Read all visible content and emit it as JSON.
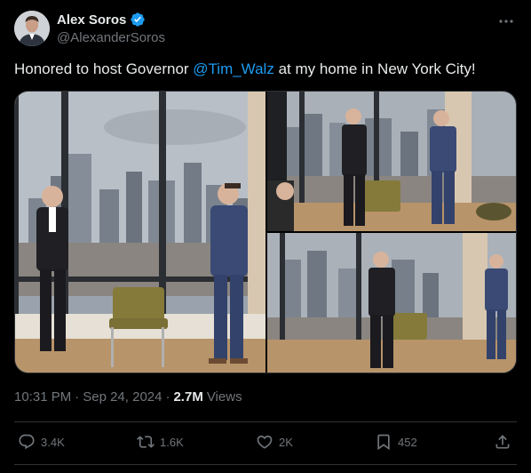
{
  "author": {
    "display_name": "Alex Soros",
    "handle": "@AlexanderSoros",
    "verified": true
  },
  "tweet": {
    "text_before": "Honored to host Governor ",
    "mention": "@Tim_Walz",
    "text_after": " at my home in New York City!"
  },
  "media": {
    "photo_count": 3
  },
  "meta": {
    "time": "10:31 PM",
    "date": "Sep 24, 2024",
    "views_count": "2.7M",
    "views_label": "Views",
    "separator": "·"
  },
  "actions": {
    "replies": "3.4K",
    "retweets": "1.6K",
    "likes": "2K",
    "bookmarks": "452"
  },
  "colors": {
    "background": "#000000",
    "text": "#e7e9ea",
    "secondary": "#71767b",
    "accent": "#1d9bf0",
    "border": "#2f3336"
  },
  "icons": {
    "verified": "verified-badge-icon",
    "more": "more-icon",
    "reply": "reply-icon",
    "retweet": "retweet-icon",
    "like": "heart-icon",
    "bookmark": "bookmark-icon",
    "share": "share-icon"
  }
}
